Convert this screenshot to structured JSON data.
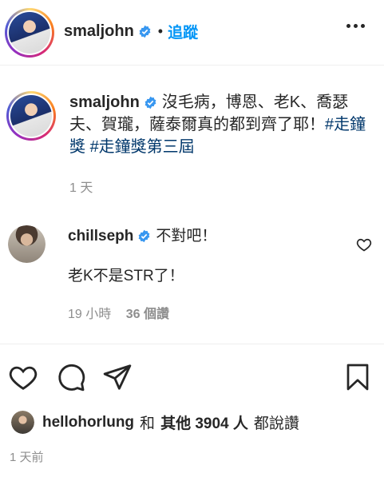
{
  "header": {
    "username": "smaljohn",
    "separator": "•",
    "follow_label": "追蹤"
  },
  "caption": {
    "username": "smaljohn",
    "text": "沒毛病，博恩、老K、喬瑟夫、賀瓏，薩泰爾真的都到齊了耶！",
    "hashtag1": "#走鐘獎",
    "hashtag2": "#走鐘獎第三屆",
    "time": "1 天"
  },
  "comment": {
    "username": "chillseph",
    "line1": "不對吧！",
    "line2": "老K不是STR了！",
    "time": "19 小時",
    "likes": "36 個讚"
  },
  "likes_bar": {
    "username": "hellohorlung",
    "and": "和",
    "others": "其他 3904 人",
    "suffix": "都說讚"
  },
  "post_time": "1 天前",
  "colors": {
    "accent": "#0095f6",
    "verified": "#3897f0",
    "hashtag": "#00376b",
    "muted": "#8e8e8e"
  },
  "icons": [
    "more-options-icon",
    "verified-badge-icon",
    "heart-icon",
    "comment-icon",
    "share-icon",
    "bookmark-icon"
  ]
}
